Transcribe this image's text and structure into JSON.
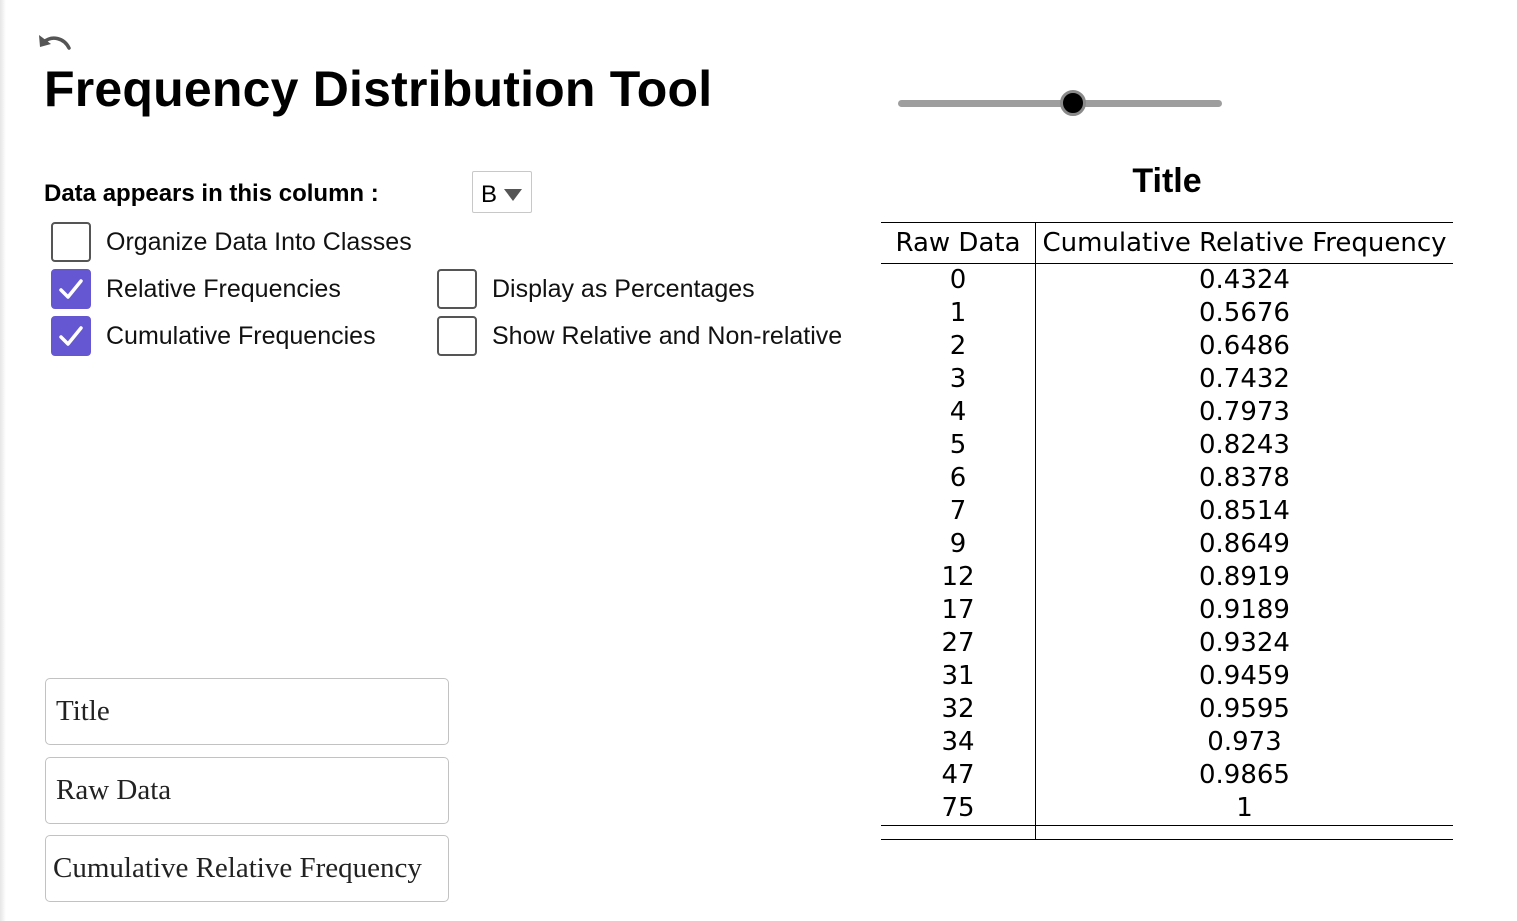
{
  "app": {
    "title": "Frequency Distribution Tool",
    "icons": {
      "undo": "undo-icon",
      "checkmark": "checkmark-icon",
      "dropdown": "chevron-down-icon"
    }
  },
  "slider": {
    "value": 0.54
  },
  "controls": {
    "column_label": "Data appears in this column :",
    "column_value": "B",
    "checkboxes": [
      {
        "label": "Organize Data Into Classes",
        "checked": false
      },
      {
        "label": "Relative Frequencies",
        "checked": true
      },
      {
        "label": "Cumulative Frequencies",
        "checked": true
      },
      {
        "label": "Display as Percentages",
        "checked": false
      },
      {
        "label": "Show Relative and Non-relative",
        "checked": false
      }
    ],
    "accent_color": "#6557d2"
  },
  "inputs": {
    "title_value": "Title",
    "raw_header_value": "Raw Data",
    "freq_header_value": "Cumulative Relative Frequency"
  },
  "table": {
    "title": "Title",
    "headers": [
      "Raw Data",
      "Cumulative Relative Frequency"
    ],
    "rows": [
      [
        "0",
        "0.4324"
      ],
      [
        "1",
        "0.5676"
      ],
      [
        "2",
        "0.6486"
      ],
      [
        "3",
        "0.7432"
      ],
      [
        "4",
        "0.7973"
      ],
      [
        "5",
        "0.8243"
      ],
      [
        "6",
        "0.8378"
      ],
      [
        "7",
        "0.8514"
      ],
      [
        "9",
        "0.8649"
      ],
      [
        "12",
        "0.8919"
      ],
      [
        "17",
        "0.9189"
      ],
      [
        "27",
        "0.9324"
      ],
      [
        "31",
        "0.9459"
      ],
      [
        "32",
        "0.9595"
      ],
      [
        "34",
        "0.973"
      ],
      [
        "47",
        "0.9865"
      ],
      [
        "75",
        "1"
      ]
    ]
  }
}
